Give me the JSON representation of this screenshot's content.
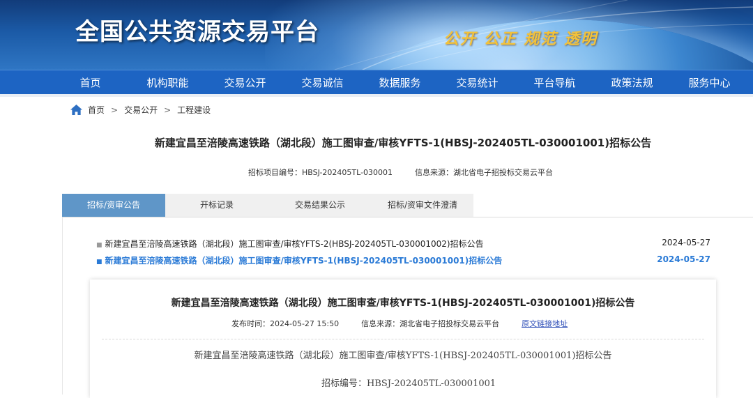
{
  "site": {
    "title": "全国公共资源交易平台",
    "slogan": "公开 公正 规范 透明"
  },
  "nav": {
    "items": [
      "首页",
      "机构职能",
      "交易公开",
      "交易诚信",
      "数据服务",
      "交易统计",
      "平台导航",
      "政策法规",
      "服务中心"
    ]
  },
  "breadcrumb": {
    "items": [
      "首页",
      "交易公开",
      "工程建设"
    ],
    "separator": ">"
  },
  "notice": {
    "title": "新建宜昌至涪陵高速铁路（湖北段）施工图审查/审核YFTS-1(HBSJ-202405TL-030001001)招标公告",
    "project_no": "招标项目编号：HBSJ-202405TL-030001",
    "source": "信息来源：湖北省电子招投标交易云平台"
  },
  "tabs": {
    "items": [
      "招标/资审公告",
      "开标记录",
      "交易结果公示",
      "招标/资审文件澄清"
    ],
    "active": 0
  },
  "list": {
    "rows": [
      {
        "title": "新建宜昌至涪陵高速铁路（湖北段）施工图审查/审核YFTS-2(HBSJ-202405TL-030001002)招标公告",
        "date": "2024-05-27"
      },
      {
        "title": "新建宜昌至涪陵高速铁路（湖北段）施工图审查/审核YFTS-1(HBSJ-202405TL-030001001)招标公告",
        "date": "2024-05-27"
      }
    ],
    "active": 1
  },
  "detail": {
    "title": "新建宜昌至涪陵高速铁路（湖北段）施工图审查/审核YFTS-1(HBSJ-202405TL-030001001)招标公告",
    "publish_time": "发布时间：2024-05-27 15:50",
    "source": "信息来源：湖北省电子招投标交易云平台",
    "original_link": "原文链接地址",
    "doc_title": "新建宜昌至涪陵高速铁路（湖北段）施工图审查/审核YFTS-1(HBSJ-202405TL-030001001)招标公告",
    "doc_tender_no": "招标编号：HBSJ-202405TL-030001001"
  },
  "colors": {
    "nav_bg": "#1d64c3",
    "tab_active": "#5f96c8",
    "list_active": "#2a7ad6",
    "slogan": "#f3c23a"
  },
  "icons": {
    "home": "home-icon"
  }
}
